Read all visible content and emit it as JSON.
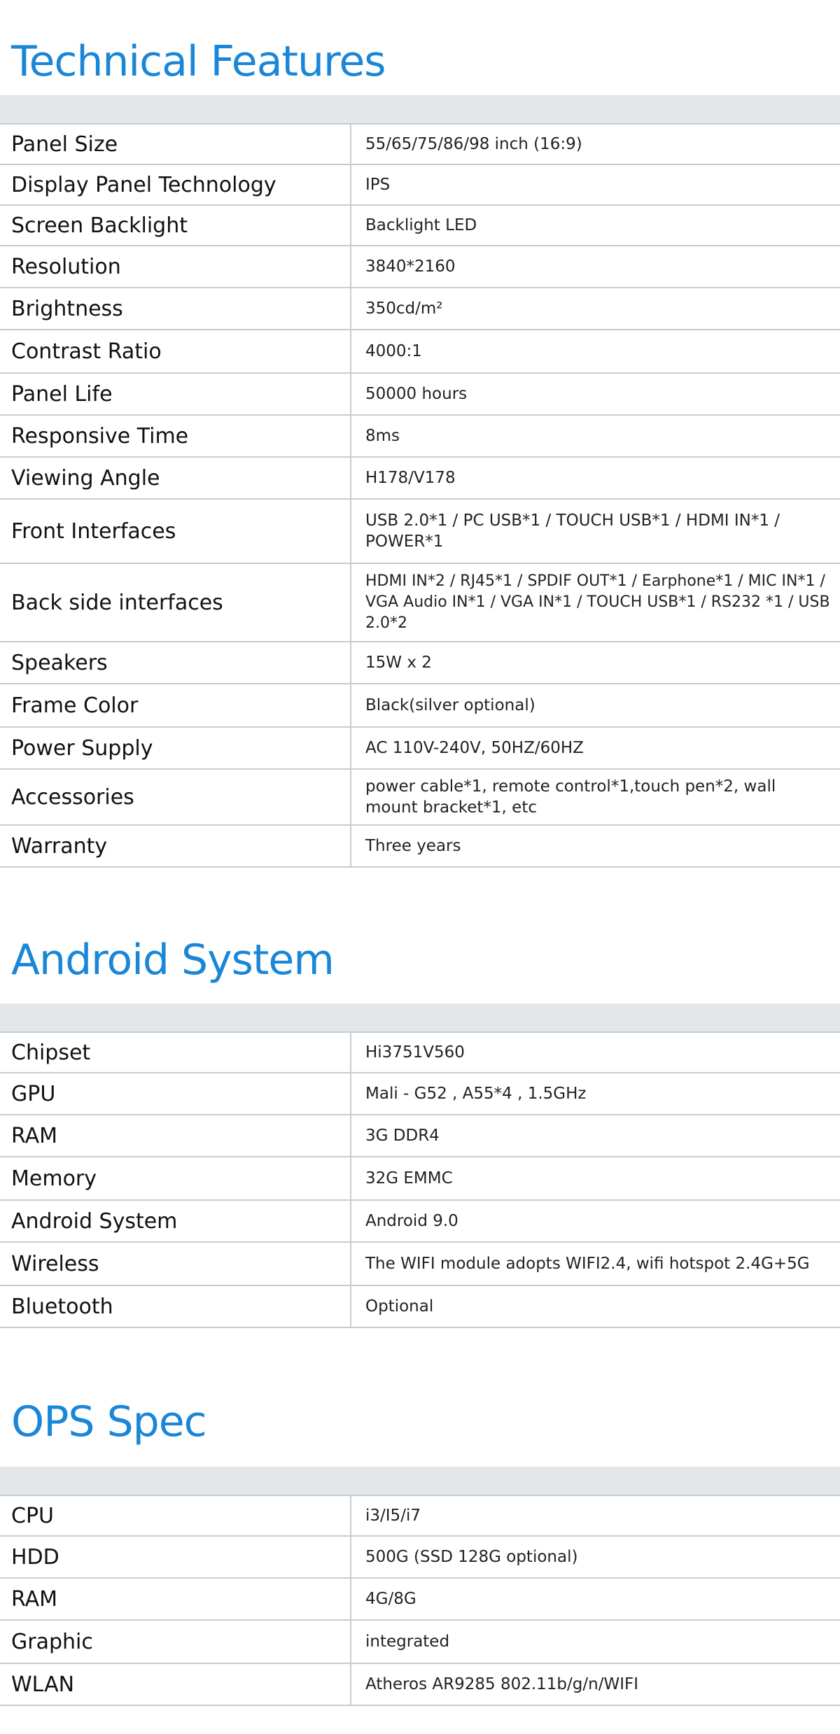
{
  "sections": [
    {
      "title": "Technical Features",
      "rows": [
        {
          "label": "Panel Size",
          "value": "55/65/75/86/98 inch (16:9)"
        },
        {
          "label": "Display Panel Technology",
          "value": "IPS"
        },
        {
          "label": "Screen Backlight",
          "value": "Backlight LED"
        },
        {
          "label": "Resolution",
          "value": "3840*2160"
        },
        {
          "label": "Brightness",
          "value": "350cd/m²"
        },
        {
          "label": "Contrast Ratio",
          "value": "4000:1"
        },
        {
          "label": "Panel Life",
          "value": "50000 hours"
        },
        {
          "label": "Responsive Time",
          "value": "8ms"
        },
        {
          "label": "Viewing Angle",
          "value": "H178/V178"
        },
        {
          "label": "Front Interfaces",
          "value": "USB 2.0*1 / PC USB*1 / TOUCH USB*1 / HDMI IN*1 / POWER*1"
        },
        {
          "label": "Back side interfaces",
          "value": "HDMI IN*2 / RJ45*1 / SPDIF OUT*1 / Earphone*1 / MIC IN*1 / VGA Audio IN*1 / VGA IN*1 / TOUCH USB*1 / RS232 *1 / USB 2.0*2"
        },
        {
          "label": "Speakers",
          "value": "15W x 2"
        },
        {
          "label": "Frame Color",
          "value": "Black(silver optional)"
        },
        {
          "label": "Power Supply",
          "value": "AC 110V-240V, 50HZ/60HZ"
        },
        {
          "label": "Accessories",
          "value": "power cable*1, remote control*1,touch pen*2, wall mount bracket*1, etc"
        },
        {
          "label": "Warranty",
          "value": "Three years"
        }
      ]
    },
    {
      "title": "Android System",
      "rows": [
        {
          "label": "Chipset",
          "value": "Hi3751V560"
        },
        {
          "label": "GPU",
          "value": "Mali - G52 , A55*4 , 1.5GHz"
        },
        {
          "label": "RAM",
          "value": "3G DDR4"
        },
        {
          "label": "Memory",
          "value": "32G EMMC"
        },
        {
          "label": "Android System",
          "value": "Android 9.0"
        },
        {
          "label": "Wireless",
          "value": "The WIFI module adopts WIFI2.4, wifi hotspot 2.4G+5G"
        },
        {
          "label": "Bluetooth",
          "value": "Optional"
        }
      ]
    },
    {
      "title": "OPS Spec",
      "rows": [
        {
          "label": "CPU",
          "value": "i3/I5/i7"
        },
        {
          "label": "HDD",
          "value": "500G (SSD 128G optional)"
        },
        {
          "label": "RAM",
          "value": "4G/8G"
        },
        {
          "label": "Graphic",
          "value": "integrated"
        },
        {
          "label": "WLAN",
          "value": "Atheros AR9285 802.11b/g/n/WIFI"
        }
      ]
    }
  ]
}
